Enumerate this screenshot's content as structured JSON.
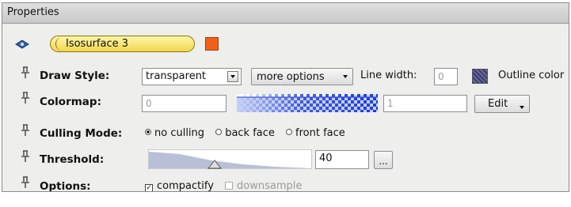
{
  "panel": {
    "title": "Properties"
  },
  "object": {
    "name": "Isosurface 3",
    "color": "#f06018"
  },
  "draw_style": {
    "label": "Draw Style:",
    "value": "transparent",
    "more_options": "more options",
    "line_width_label": "Line width:",
    "line_width_value": "0",
    "outline_label": "Outline color"
  },
  "colormap": {
    "label": "Colormap:",
    "min_value": "0",
    "max_value": "1",
    "edit_label": "Edit"
  },
  "culling": {
    "label": "Culling Mode:",
    "options": [
      "no culling",
      "back face",
      "front face"
    ],
    "selected": "no culling"
  },
  "threshold": {
    "label": "Threshold:",
    "value": "40",
    "more_label": "..."
  },
  "options": {
    "label": "Options:",
    "compactify": "compactify",
    "compactify_checked": true,
    "downsample": "downsample",
    "downsample_checked": false
  }
}
